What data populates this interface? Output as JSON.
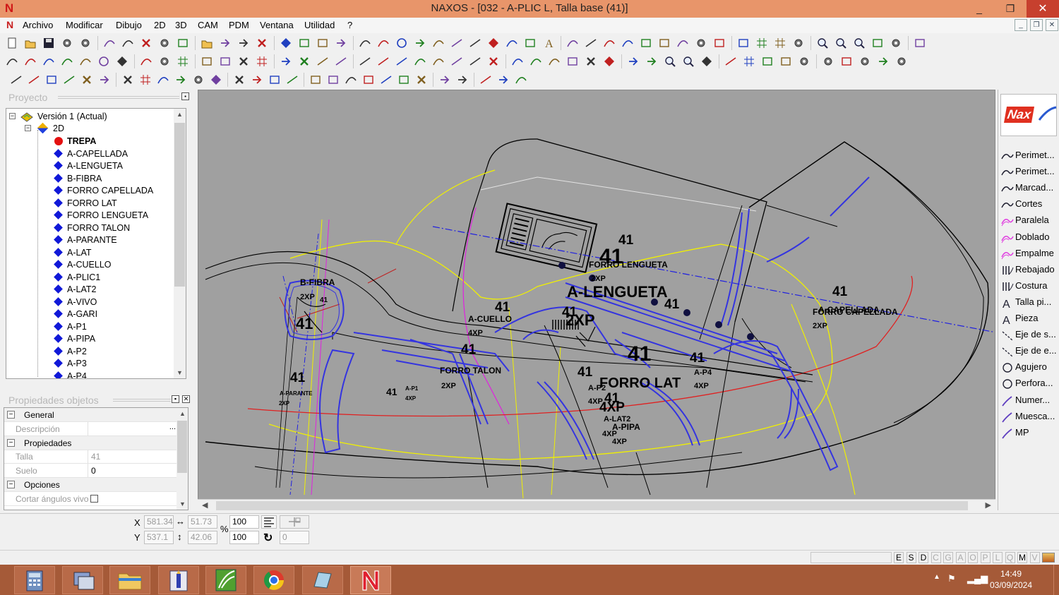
{
  "window": {
    "title": "NAXOS - [032 - A-PLIC L, Talla base (41)]",
    "controls": [
      "_",
      "❐",
      "✕"
    ]
  },
  "menu": {
    "items": [
      "Archivo",
      "Modificar",
      "Dibujo",
      "2D",
      "3D",
      "CAM",
      "PDM",
      "Ventana",
      "Utilidad",
      "?"
    ]
  },
  "project_panel": {
    "header": "Proyecto",
    "version": "Versión 1 (Actual)",
    "folder": "2D",
    "items": [
      "TREPA",
      "A-CAPELLADA",
      "A-LENGUETA",
      "B-FIBRA",
      "FORRO CAPELLADA",
      "FORRO LAT",
      "FORRO LENGUETA",
      "FORRO TALON",
      "A-PARANTE",
      "A-LAT",
      "A-CUELLO",
      "A-PLIC1",
      "A-LAT2",
      "A-VIVO",
      "A-GARI",
      "A-P1",
      "A-PIPA",
      "A-P2",
      "A-P3",
      "A-P4"
    ]
  },
  "properties_panel": {
    "header": "Propiedades objetos",
    "rows": [
      {
        "type": "cat",
        "name": "General"
      },
      {
        "type": "prop",
        "name": "Descripción",
        "value": "",
        "button": "..."
      },
      {
        "type": "cat",
        "name": "Propiedades"
      },
      {
        "type": "prop",
        "name": "Talla",
        "value": "41"
      },
      {
        "type": "prop",
        "name": "Suelo",
        "value": "0"
      },
      {
        "type": "cat",
        "name": "Opciones"
      },
      {
        "type": "prop",
        "name": "Cortar ángulos vivo",
        "value": ""
      }
    ]
  },
  "canvas_labels": [
    {
      "text": "41",
      "size": 19,
      "weight": "bold"
    },
    {
      "text": "41",
      "size": 30,
      "weight": "bold"
    },
    {
      "text": "FORRO LENGUETA",
      "size": 12,
      "weight": "bold"
    },
    {
      "text": "2XP",
      "size": 11,
      "weight": "bold"
    },
    {
      "text": "A-LENGUETA",
      "size": 22,
      "weight": "bold"
    },
    {
      "text": "41",
      "size": 19,
      "weight": "bold"
    },
    {
      "text": "B-FIBRA",
      "size": 12,
      "weight": "bold"
    },
    {
      "text": "2XP",
      "size": 11,
      "weight": "bold"
    },
    {
      "text": "41",
      "size": 10,
      "weight": "bold"
    },
    {
      "text": "41",
      "size": 22,
      "weight": "bold"
    },
    {
      "text": "41",
      "size": 19,
      "weight": "bold"
    },
    {
      "text": "A-CUELLO",
      "size": 12,
      "weight": "bold"
    },
    {
      "text": "4XP",
      "size": 11,
      "weight": "bold"
    },
    {
      "text": "41",
      "size": 19,
      "weight": "bold"
    },
    {
      "text": "2XP",
      "size": 22,
      "weight": "bold"
    },
    {
      "text": "41",
      "size": 19,
      "weight": "bold"
    },
    {
      "text": "A-CAPELLADA",
      "size": 12,
      "weight": "bold"
    },
    {
      "text": "FORRO CAPELLADA",
      "size": 12,
      "weight": "bold"
    },
    {
      "text": "2XP",
      "size": 11,
      "weight": "bold"
    },
    {
      "text": "41",
      "size": 19,
      "weight": "bold"
    },
    {
      "text": "41",
      "size": 30,
      "weight": "bold"
    },
    {
      "text": "41",
      "size": 19,
      "weight": "bold"
    },
    {
      "text": "A-P4",
      "size": 11,
      "weight": "bold"
    },
    {
      "text": "4XP",
      "size": 11,
      "weight": "bold"
    },
    {
      "text": "FORRO TALON",
      "size": 12,
      "weight": "bold"
    },
    {
      "text": "2XP",
      "size": 11,
      "weight": "bold"
    },
    {
      "text": "41",
      "size": 19,
      "weight": "bold"
    },
    {
      "text": "FORRO LAT",
      "size": 20,
      "weight": "bold"
    },
    {
      "text": "A-P2",
      "size": 11,
      "weight": "bold"
    },
    {
      "text": "4XP",
      "size": 11,
      "weight": "bold"
    },
    {
      "text": "41",
      "size": 19,
      "weight": "bold"
    },
    {
      "text": "A-PARANTE",
      "size": 8,
      "weight": "bold"
    },
    {
      "text": "2XP",
      "size": 8,
      "weight": "bold"
    },
    {
      "text": "41",
      "size": 14,
      "weight": "bold"
    },
    {
      "text": "A-P1",
      "size": 8,
      "weight": "bold"
    },
    {
      "text": "4XP",
      "size": 8,
      "weight": "bold"
    },
    {
      "text": "41",
      "size": 19,
      "weight": "bold"
    },
    {
      "text": "4XP",
      "size": 19,
      "weight": "bold"
    },
    {
      "text": "A-LAT2",
      "size": 11,
      "weight": "bold"
    },
    {
      "text": "A-PIPA",
      "size": 12,
      "weight": "bold"
    },
    {
      "text": "4XP",
      "size": 11,
      "weight": "bold"
    },
    {
      "text": "4XP",
      "size": 11,
      "weight": "bold"
    }
  ],
  "palette": {
    "logo": "Nax",
    "items": [
      {
        "label": "Perimet...",
        "icon": "curve-icon"
      },
      {
        "label": "Perimet...",
        "icon": "curve-icon"
      },
      {
        "label": "Marcad...",
        "icon": "curve-icon"
      },
      {
        "label": "Cortes",
        "icon": "curve-icon"
      },
      {
        "label": "Paralela",
        "icon": "pink-curve-icon"
      },
      {
        "label": "Doblado",
        "icon": "pink-curve-icon"
      },
      {
        "label": "Empalme",
        "icon": "pink-curve-icon"
      },
      {
        "label": "Rebajado",
        "icon": "stitch-icon"
      },
      {
        "label": "Costura",
        "icon": "stitch-icon"
      },
      {
        "label": "Talla pi...",
        "icon": "text-a-icon"
      },
      {
        "label": "Pieza",
        "icon": "text-a-icon"
      },
      {
        "label": "Eje de s...",
        "icon": "axis-icon"
      },
      {
        "label": "Eje de e...",
        "icon": "axis-icon"
      },
      {
        "label": "Agujero",
        "icon": "circle-icon"
      },
      {
        "label": "Perfora...",
        "icon": "circle-icon"
      },
      {
        "label": "Numer...",
        "icon": "pen-icon"
      },
      {
        "label": "Muesca...",
        "icon": "pen-icon"
      },
      {
        "label": "MP",
        "icon": "pen-icon"
      }
    ]
  },
  "coords": {
    "x_label": "X",
    "y_label": "Y",
    "x": "581.34",
    "y": "537.1",
    "dx": "51.73",
    "dy": "42.06",
    "pct_label": "%",
    "scale_x": "100",
    "scale_y": "100",
    "rotation": "0"
  },
  "statusbar": {
    "toggles": [
      "E",
      "S",
      "D",
      "C",
      "G",
      "A",
      "O",
      "P",
      "L",
      "Q",
      "M",
      "V"
    ]
  },
  "taskbar": {
    "time": "14:49",
    "date": "03/09/2024"
  },
  "colors": {
    "titlebar": "#e8956a",
    "taskbar": "#a55a38",
    "canvas": "#a0a0a0",
    "piece_blue": "#3434e0",
    "tree_diamond": "#1018d8"
  }
}
